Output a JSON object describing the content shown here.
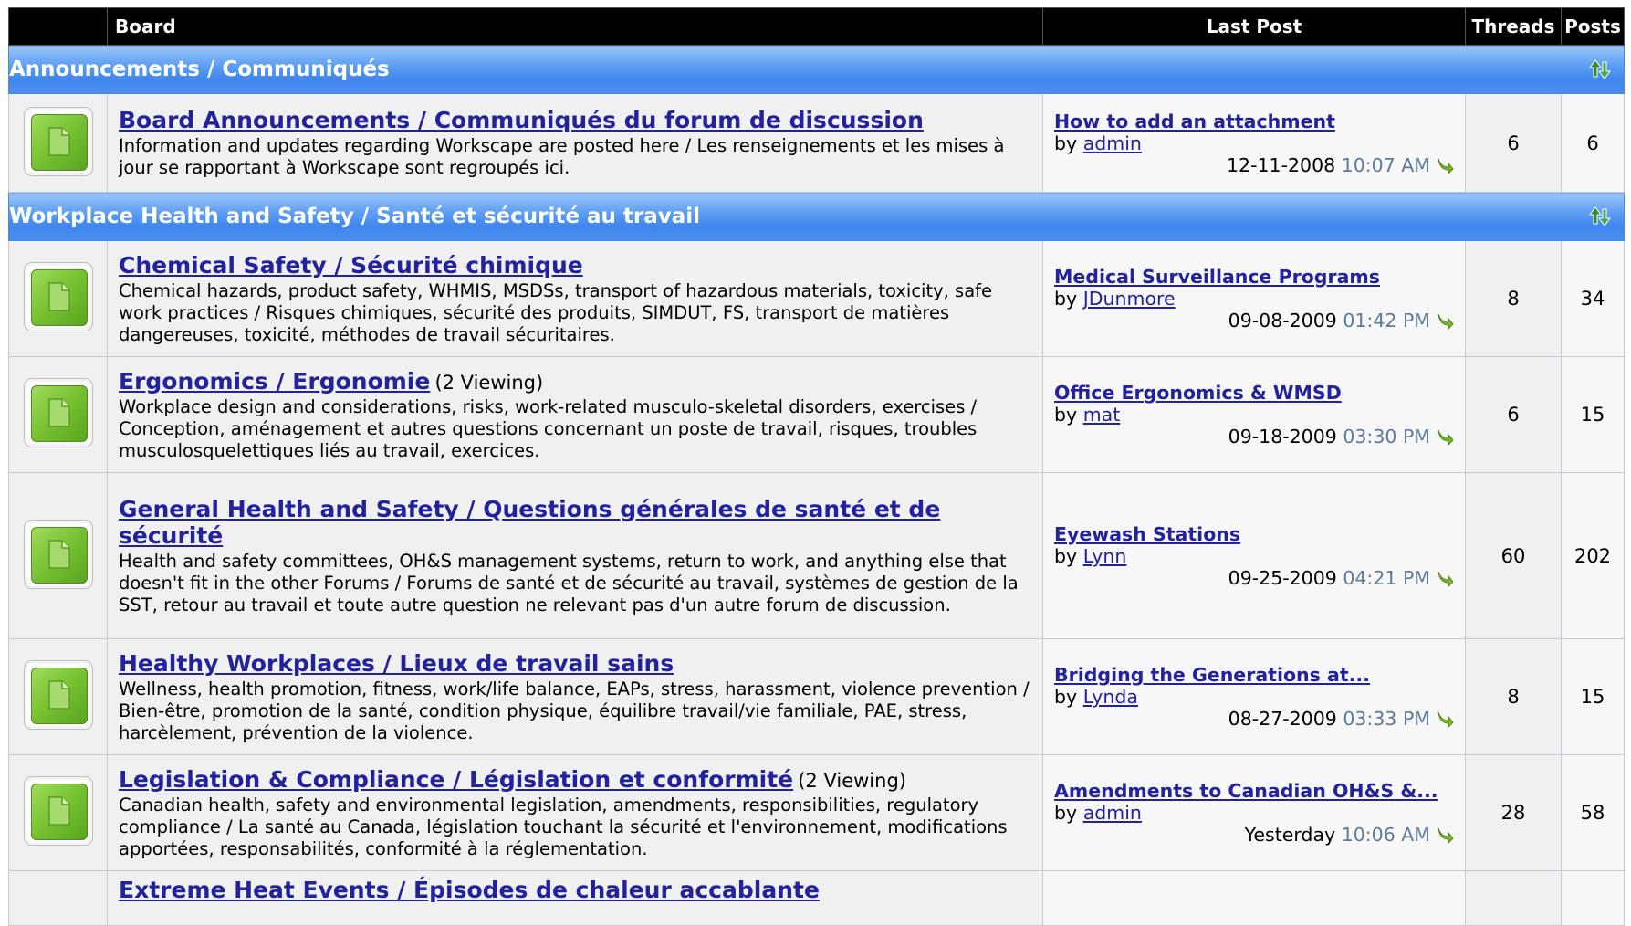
{
  "header": {
    "board": "Board",
    "last_post": "Last Post",
    "threads": "Threads",
    "posts": "Posts"
  },
  "categories": [
    {
      "title": "Announcements / Communiqués"
    },
    {
      "title": "Workplace Health and Safety / Santé et sécurité au travail"
    }
  ],
  "boards": [
    {
      "title": "Board Announcements / Communiqués du forum de discussion",
      "viewing": "",
      "description": "Information and updates regarding Workscape are posted here / Les renseignements et les mises à jour se rapportant à Workscape sont regroupés ici.",
      "last_post": {
        "title": "How to add an attachment",
        "by": "by",
        "user": "admin",
        "date": "12-11-2008",
        "time": "10:07 AM"
      },
      "threads": "6",
      "posts": "6"
    },
    {
      "title": "Chemical Safety / Sécurité chimique",
      "viewing": "",
      "description": "Chemical hazards, product safety, WHMIS, MSDSs, transport of hazardous materials, toxicity, safe work practices / Risques chimiques, sécurité des produits, SIMDUT, FS, transport de matières dangereuses, toxicité, méthodes de travail sécuritaires.",
      "last_post": {
        "title": "Medical Surveillance Programs",
        "by": "by",
        "user": "JDunmore",
        "date": "09-08-2009",
        "time": "01:42 PM"
      },
      "threads": "8",
      "posts": "34"
    },
    {
      "title": "Ergonomics / Ergonomie",
      "viewing": "(2 Viewing)",
      "description": "Workplace design and considerations, risks, work-related musculo-skeletal disorders, exercises / Conception, aménagement et autres questions concernant un poste de travail, risques, troubles musculosquelettiques liés au travail, exercices.",
      "last_post": {
        "title": "Office Ergonomics & WMSD",
        "by": "by",
        "user": "mat",
        "date": "09-18-2009",
        "time": "03:30 PM"
      },
      "threads": "6",
      "posts": "15"
    },
    {
      "title": "General Health and Safety / Questions générales de santé et de sécurité",
      "viewing": "",
      "description": "Health and safety committees, OH&S management systems, return to work, and anything else that doesn't fit in the other Forums / Forums de santé et de sécurité au travail, systèmes de gestion de la SST, retour au travail et toute autre question ne relevant pas d'un autre forum de discussion.",
      "last_post": {
        "title": "Eyewash Stations",
        "by": "by",
        "user": "Lynn",
        "date": "09-25-2009",
        "time": "04:21 PM"
      },
      "threads": "60",
      "posts": "202"
    },
    {
      "title": "Healthy Workplaces / Lieux de travail sains",
      "viewing": "",
      "description": "Wellness, health promotion, fitness, work/life balance, EAPs, stress, harassment, violence prevention / Bien-être, promotion de la santé, condition physique, équilibre travail/vie familiale, PAE, stress, harcèlement, prévention de la violence.",
      "last_post": {
        "title": "Bridging the Generations at...",
        "by": "by",
        "user": "Lynda",
        "date": "08-27-2009",
        "time": "03:33 PM"
      },
      "threads": "8",
      "posts": "15"
    },
    {
      "title": "Legislation & Compliance / Législation et conformité",
      "viewing": "(2 Viewing)",
      "description": "Canadian health, safety and environmental legislation, amendments, responsibilities, regulatory compliance / La santé au Canada, législation touchant la sécurité et l'environnement, modifications apportées, responsabilités, conformité à la réglementation.",
      "last_post": {
        "title": "Amendments to Canadian OH&S &...",
        "by": "by",
        "user": "admin",
        "date": "Yesterday",
        "time": "10:06 AM"
      },
      "threads": "28",
      "posts": "58"
    },
    {
      "title": "Extreme Heat Events / Épisodes de chaleur accablante",
      "viewing": "",
      "description": "",
      "last_post": {
        "title": "",
        "by": "",
        "user": "",
        "date": "",
        "time": ""
      },
      "threads": "",
      "posts": ""
    }
  ]
}
